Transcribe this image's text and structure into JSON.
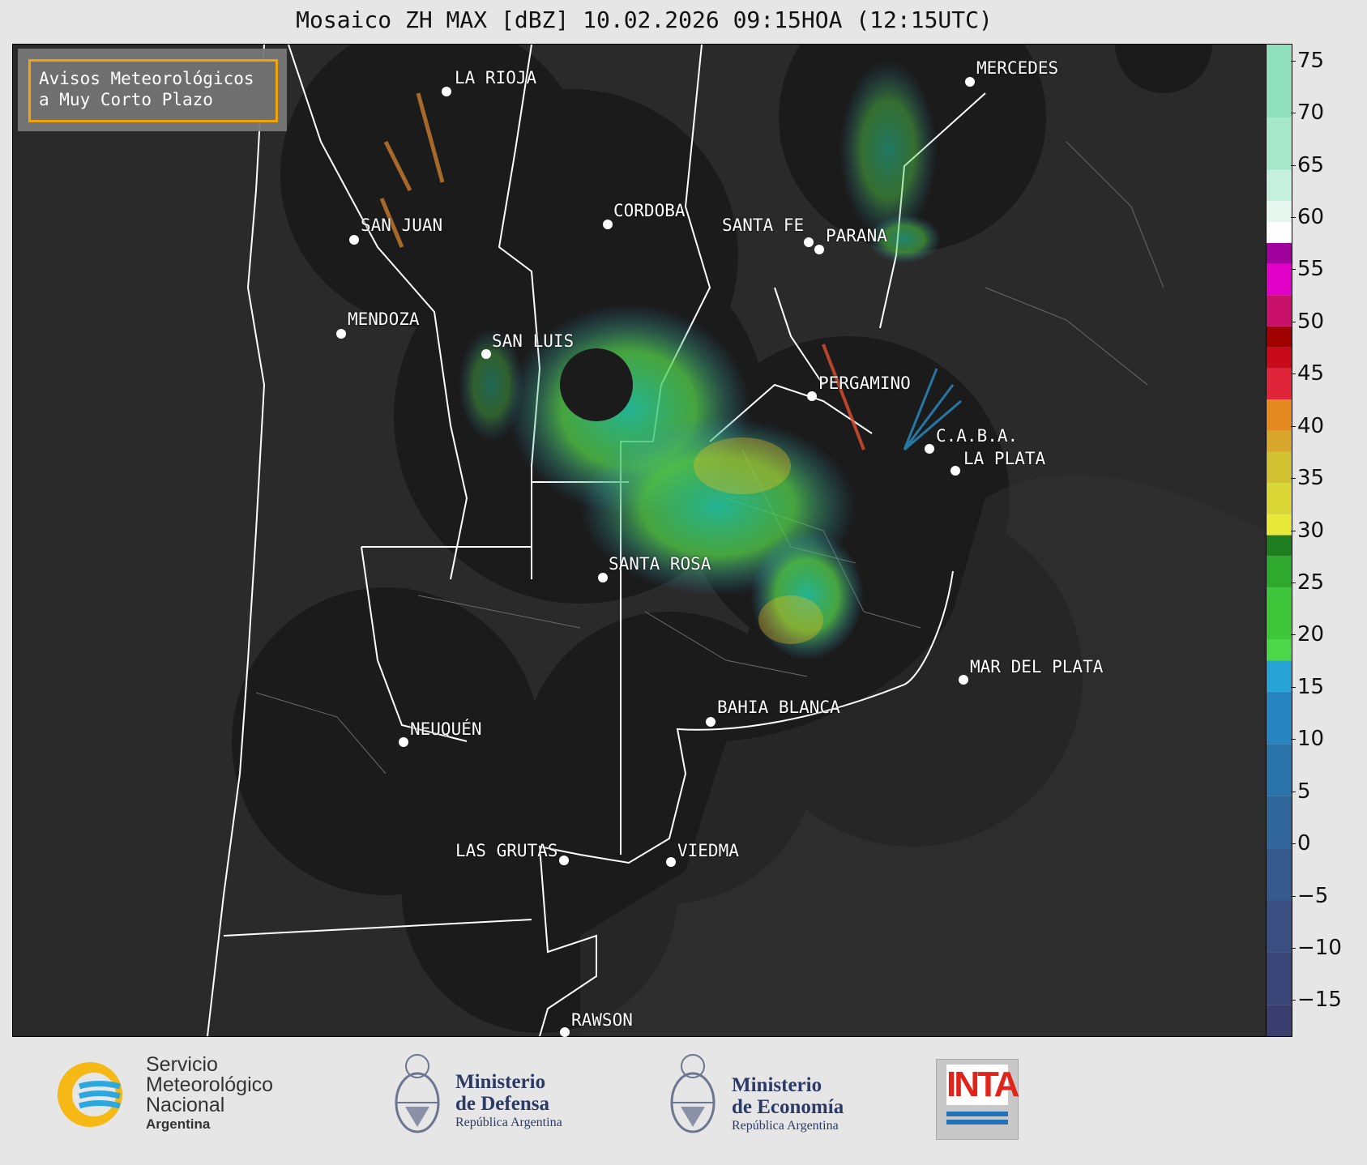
{
  "title": "Mosaico ZH MAX [dBZ] 10.02.2026 09:15HOA (12:15UTC)",
  "legend": {
    "line1": "Avisos Meteorológicos",
    "line2": "a Muy Corto Plazo",
    "border_color": "#f2a20b"
  },
  "cities": [
    {
      "name": "LA RIOJA"
    },
    {
      "name": "MERCEDES"
    },
    {
      "name": "CORDOBA"
    },
    {
      "name": "SAN JUAN"
    },
    {
      "name": "SANTA FE"
    },
    {
      "name": "PARANA"
    },
    {
      "name": "MENDOZA"
    },
    {
      "name": "SAN LUIS"
    },
    {
      "name": "PERGAMINO"
    },
    {
      "name": "C.A.B.A."
    },
    {
      "name": "LA PLATA"
    },
    {
      "name": "SANTA ROSA"
    },
    {
      "name": "MAR DEL PLATA"
    },
    {
      "name": "BAHIA BLANCA"
    },
    {
      "name": "NEUQUÉN"
    },
    {
      "name": "LAS GRUTAS"
    },
    {
      "name": "VIEDMA"
    },
    {
      "name": "RAWSON"
    }
  ],
  "colorbar": {
    "ticks": [
      "75",
      "70",
      "65",
      "60",
      "55",
      "50",
      "45",
      "40",
      "35",
      "30",
      "25",
      "20",
      "15",
      "10",
      "5",
      "0",
      "−5",
      "−10",
      "−15"
    ],
    "range": [
      -18,
      77
    ]
  },
  "footer": {
    "smn_line1": "Servicio",
    "smn_line2": "Meteorológico",
    "smn_line3": "Nacional",
    "smn_line4": "Argentina",
    "defensa_line1": "Ministerio",
    "defensa_line2": "de Defensa",
    "defensa_line3": "República Argentina",
    "economia_line1": "Ministerio",
    "economia_line2": "de Economía",
    "economia_line3": "República Argentina",
    "inta_label": "INTA"
  },
  "colors": {
    "map_bg": "#2a2a2a",
    "radar_disc": "#1b1b1b",
    "smn_yellow": "#f6b814",
    "smn_blue": "#2aa8df"
  }
}
